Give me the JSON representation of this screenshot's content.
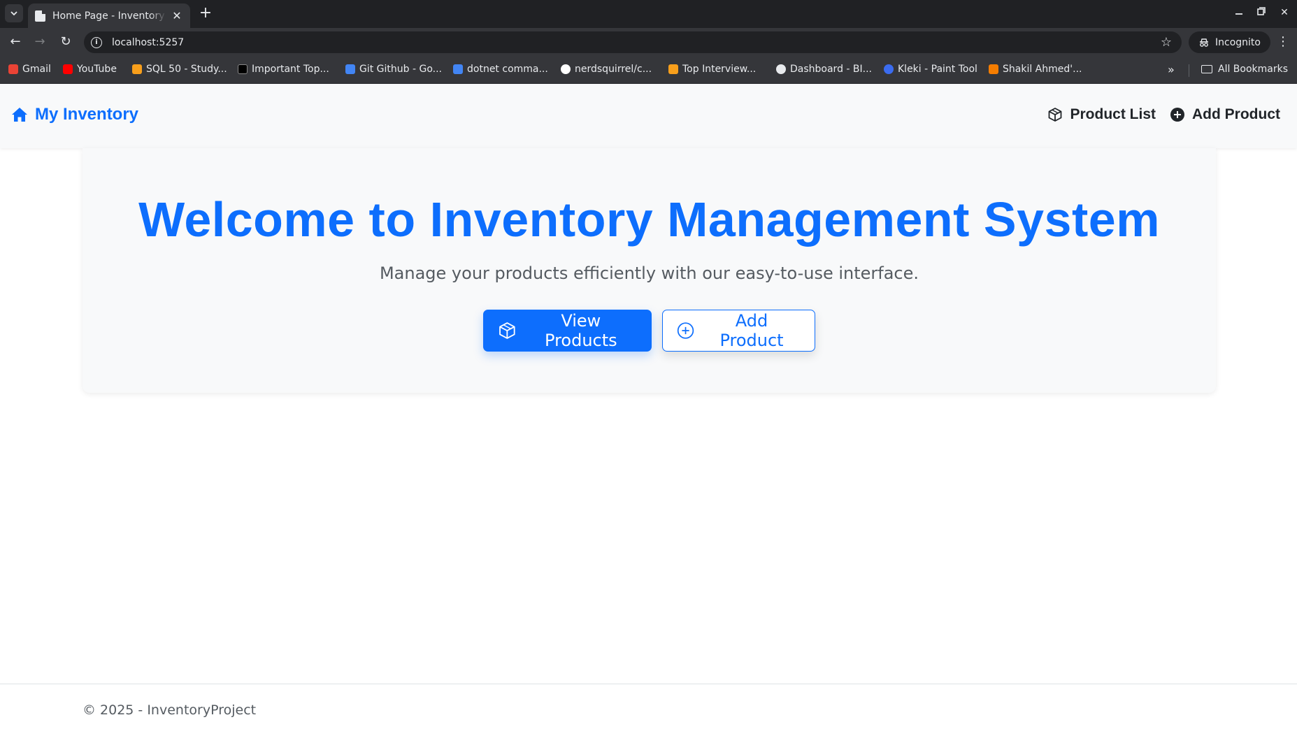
{
  "browser": {
    "tab_title": "Home Page - Inventory Management",
    "url": "localhost:5257",
    "profile_label": "Incognito",
    "bookmarks": [
      {
        "label": "Gmail",
        "icon": "gmail-icon",
        "color": "#ea4335"
      },
      {
        "label": "YouTube",
        "icon": "youtube-icon",
        "color": "#ff0000"
      },
      {
        "label": "SQL 50 - Study...",
        "icon": "leetcode-icon",
        "color": "#f89f1b"
      },
      {
        "label": "Important Top...",
        "icon": "medium-icon",
        "color": "#000000"
      },
      {
        "label": "Git Github - Go...",
        "icon": "google-docs-icon",
        "color": "#4285f4"
      },
      {
        "label": "dotnet comma...",
        "icon": "google-docs-icon",
        "color": "#4285f4"
      },
      {
        "label": "nerdsquirrel/c...",
        "icon": "github-icon",
        "color": "#ffffff"
      },
      {
        "label": "Top Interview...",
        "icon": "leetcode-icon",
        "color": "#f89f1b"
      },
      {
        "label": "Dashboard - BI...",
        "icon": "globe-icon",
        "color": "#e8eaed"
      },
      {
        "label": "Kleki - Paint Tool",
        "icon": "kleki-icon",
        "color": "#3b6cf0"
      },
      {
        "label": "Shakil Ahmed'...",
        "icon": "blogger-icon",
        "color": "#f57d00"
      }
    ],
    "all_bookmarks_label": "All Bookmarks"
  },
  "navbar": {
    "brand": "My Inventory",
    "links": [
      {
        "label": "Product List",
        "icon": "box-icon"
      },
      {
        "label": "Add Product",
        "icon": "plus-circle-icon"
      }
    ]
  },
  "hero": {
    "title": "Welcome to Inventory Management System",
    "subtitle": "Manage your products efficiently with our easy-to-use interface.",
    "primary_button": "View Products",
    "secondary_button": "Add Product"
  },
  "footer": {
    "text": "© 2025 - InventoryProject"
  },
  "colors": {
    "accent": "#0d6efd",
    "navbar_bg": "#f8f9fa"
  }
}
